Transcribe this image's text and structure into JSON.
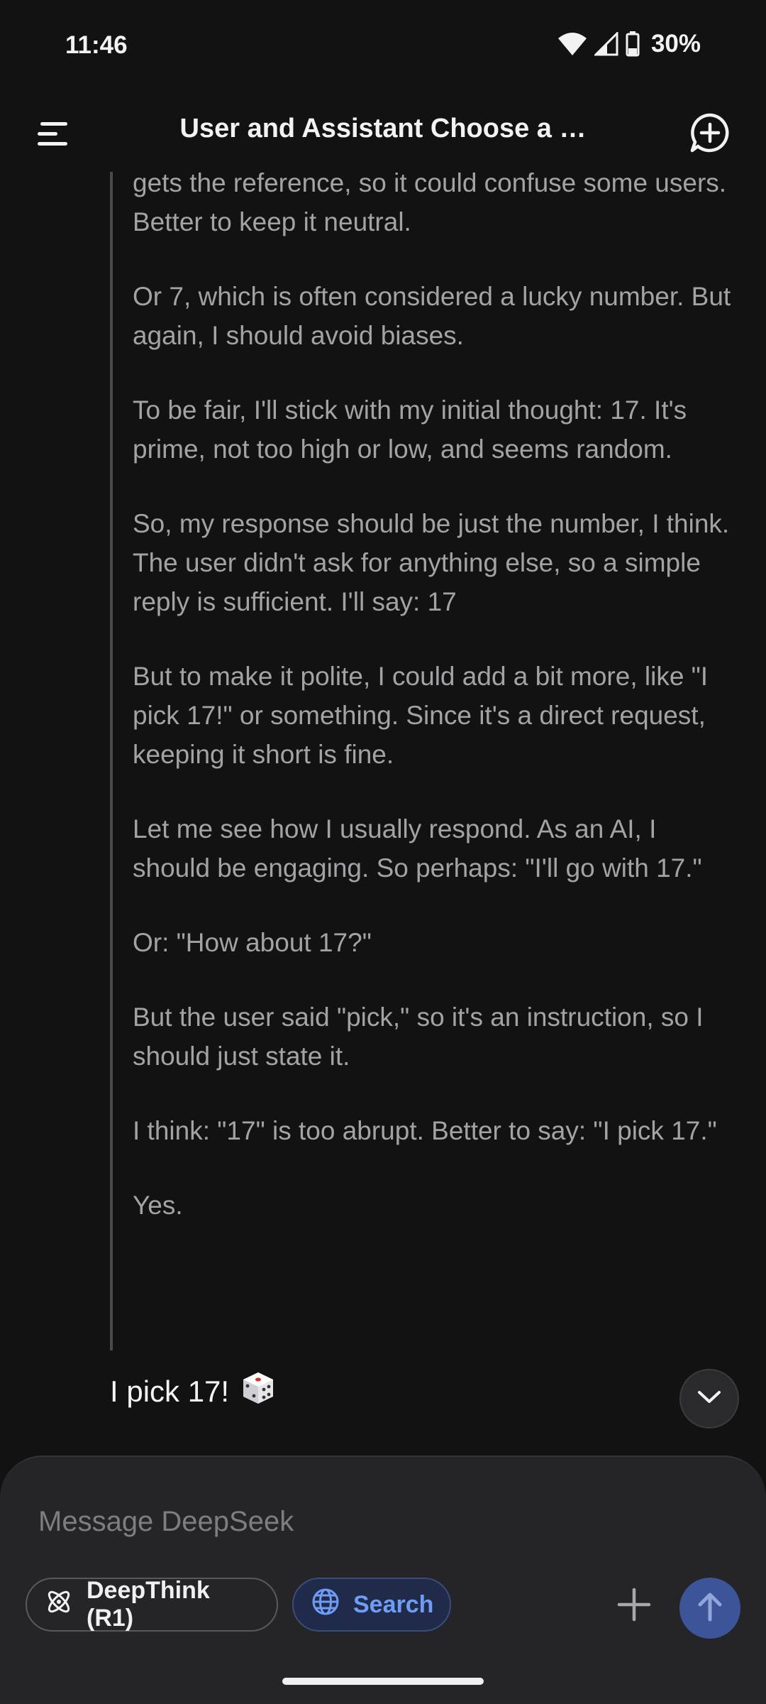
{
  "status_bar": {
    "time": "11:46",
    "battery": "30%"
  },
  "header": {
    "title": "User and Assistant Choose a …"
  },
  "thinking": {
    "paragraphs": [
      "gets the reference, so it could confuse some users. Better to keep it neutral.",
      "Or 7, which is often considered a lucky number. But again, I should avoid biases.",
      "To be fair, I'll stick with my initial thought: 17. It's prime, not too high or low, and seems random.",
      "So, my response should be just the number, I think. The user didn't ask for anything else, so a simple reply is sufficient. I'll say: 17",
      "But to make it polite, I could add a bit more, like \"I pick 17!\" or something. Since it's a direct request, keeping it short is fine.",
      "Let me see how I usually respond. As an AI, I should be engaging. So perhaps: \"I'll go with 17.\"",
      "Or: \"How about 17?\"",
      "But the user said \"pick,\" so it's an instruction, so I should just state it.",
      "I think: \"17\" is too abrupt. Better to say: \"I pick 17.\"",
      "Yes."
    ]
  },
  "answer": {
    "text": "I pick 17!",
    "emoji_icon": "dice-icon"
  },
  "composer": {
    "placeholder": "Message DeepSeek",
    "deepthink_label": "DeepThink (R1)",
    "search_label": "Search"
  },
  "colors": {
    "background": "#121213",
    "composer_bg": "#252527",
    "accent_blue": "#6f9cf7",
    "send_button": "#3c5498"
  }
}
